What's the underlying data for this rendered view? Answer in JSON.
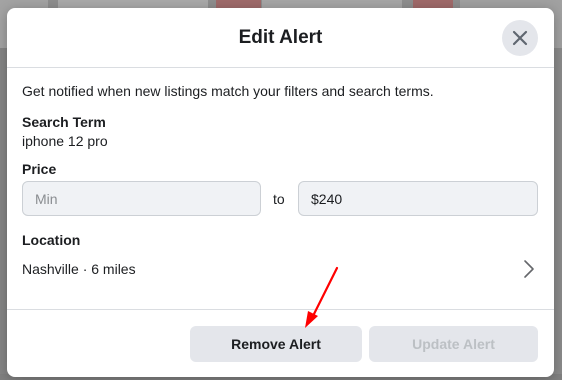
{
  "dialog": {
    "title": "Edit Alert",
    "description": "Get notified when new listings match your filters and search terms."
  },
  "search_term": {
    "label": "Search Term",
    "value": "iphone 12 pro"
  },
  "price": {
    "label": "Price",
    "min_placeholder": "Min",
    "separator": "to",
    "max_value": "$240"
  },
  "location": {
    "label": "Location",
    "value": "Nashville · 6 miles"
  },
  "buttons": {
    "remove": "Remove Alert",
    "update": "Update Alert"
  },
  "colors": {
    "annotation_arrow": "#ff0000",
    "button_bg": "#e4e6eb",
    "disabled_text": "#bcc0c4"
  },
  "icons": {
    "close": "close-icon",
    "chevron": "chevron-right-icon",
    "arrow": "red-arrow-annotation"
  }
}
